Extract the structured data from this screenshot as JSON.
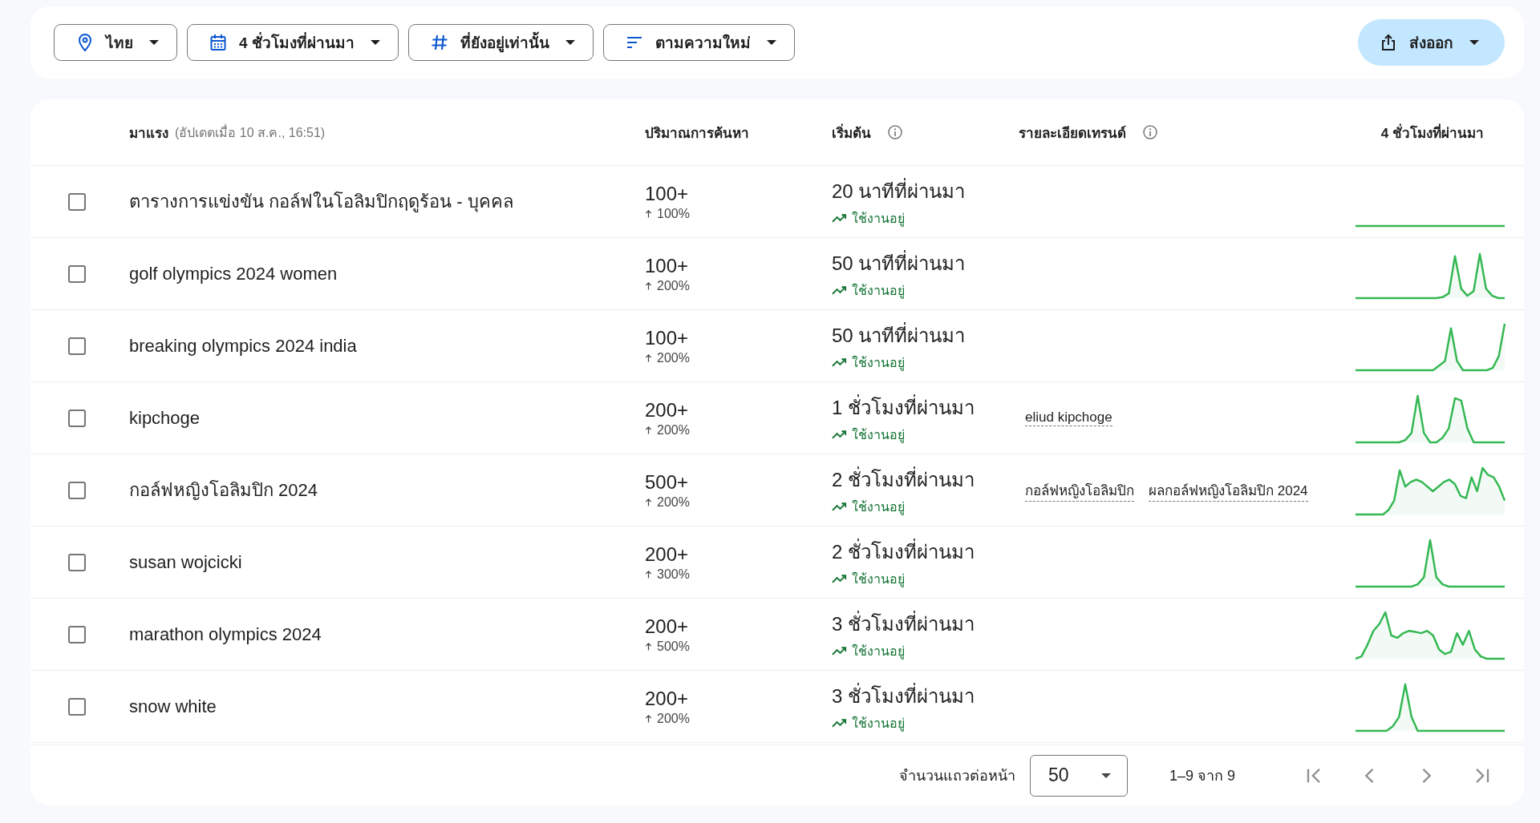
{
  "filters": [
    {
      "kind": "location",
      "label": "ไทย"
    },
    {
      "kind": "time",
      "label": "4 ชั่วโมงที่ผ่านมา"
    },
    {
      "kind": "status",
      "label": "ที่ยังอยู่เท่านั้น"
    },
    {
      "kind": "sort",
      "label": "ตามความใหม่"
    }
  ],
  "export_button": {
    "label": "ส่งออก"
  },
  "table": {
    "columns": [
      {
        "label": "มาแรง",
        "note": "(อัปเดตเมื่อ 10 ส.ค., 16:51)",
        "info": false
      },
      {
        "label": "ปริมาณการค้นหา",
        "info": false
      },
      {
        "label": "เริ่มต้น",
        "info": true
      },
      {
        "label": "รายละเอียดเทรนด์",
        "info": true
      },
      {
        "label": "4 ชั่วโมงที่ผ่านมา",
        "info": false
      }
    ],
    "rows": [
      {
        "checked": false,
        "title": "ตารางการแข่งขัน กอล์ฟในโอลิมปิกฤดูร้อน - บุคคล",
        "volume": "100+",
        "change": "100%",
        "started": "20 นาทีที่ผ่านมา",
        "status": "ใช้งานอยู่"
      },
      {
        "checked": false,
        "title": "golf olympics 2024 women",
        "volume": "100+",
        "change": "200%",
        "started": "50 นาทีที่ผ่านมา",
        "status": "ใช้งานอยู่"
      },
      {
        "checked": false,
        "title": "breaking olympics 2024 india",
        "volume": "100+",
        "change": "200%",
        "started": "50 นาทีที่ผ่านมา",
        "status": "ใช้งานอยู่"
      },
      {
        "checked": false,
        "title": "kipchoge",
        "volume": "200+",
        "change": "200%",
        "started": "1 ชั่วโมงที่ผ่านมา",
        "status": "ใช้งานอยู่",
        "details": [
          "eliud kipchoge"
        ]
      },
      {
        "checked": false,
        "title": "กอล์ฟหญิงโอลิมปิก 2024",
        "volume": "500+",
        "change": "200%",
        "started": "2 ชั่วโมงที่ผ่านมา",
        "status": "ใช้งานอยู่",
        "details": [
          "กอล์ฟหญิงโอลิมปิก",
          "ผลกอล์ฟหญิงโอลิมปิก 2024"
        ]
      },
      {
        "checked": false,
        "title": "susan wojcicki",
        "volume": "200+",
        "change": "300%",
        "started": "2 ชั่วโมงที่ผ่านมา",
        "status": "ใช้งานอยู่"
      },
      {
        "checked": false,
        "title": "marathon olympics 2024",
        "volume": "200+",
        "change": "500%",
        "started": "3 ชั่วโมงที่ผ่านมา",
        "status": "ใช้งานอยู่"
      },
      {
        "checked": false,
        "title": "snow white",
        "volume": "200+",
        "change": "200%",
        "started": "3 ชั่วโมงที่ผ่านมา",
        "status": "ใช้งานอยู่"
      }
    ]
  },
  "footer": {
    "rows_per_page_label": "จำนวนแถวต่อหน้า",
    "rows_per_page": "50",
    "range": "1–9 จาก 9"
  }
}
